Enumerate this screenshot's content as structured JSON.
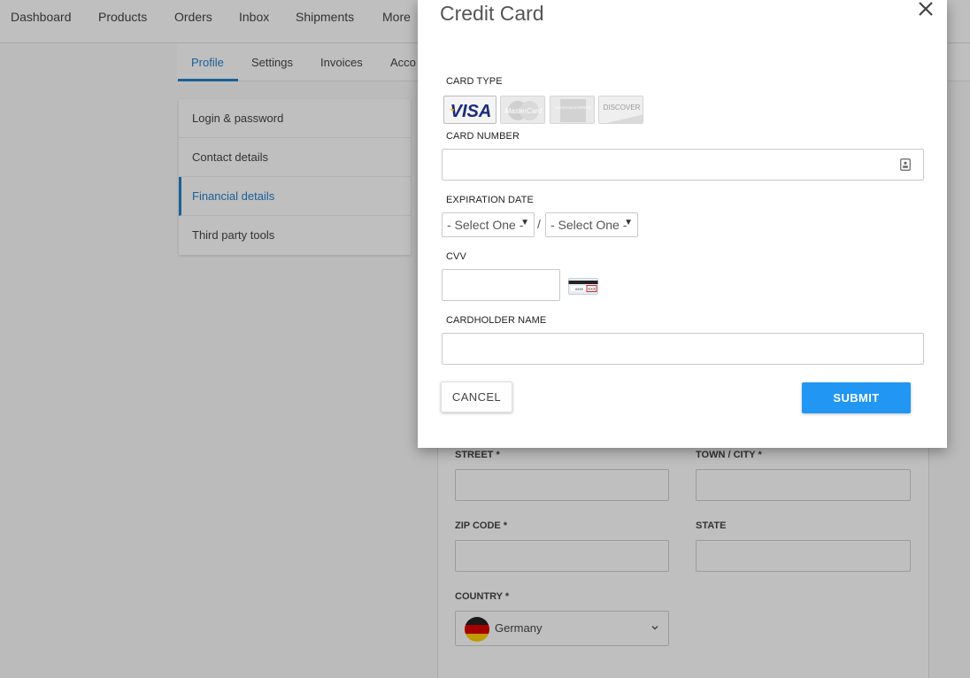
{
  "topnav": {
    "items": [
      "Dashboard",
      "Products",
      "Orders",
      "Inbox",
      "Shipments",
      "More"
    ]
  },
  "subtabs": {
    "items": [
      "Profile",
      "Settings",
      "Invoices",
      "Acco"
    ],
    "active": "Profile",
    "accent_color": "#2680c9"
  },
  "side_menu": {
    "items": [
      "Login & password",
      "Contact details",
      "Financial details",
      "Third party tools"
    ],
    "active": "Financial details"
  },
  "address_form": {
    "street_label": "STREET *",
    "town_label": "TOWN / CITY *",
    "zip_label": "ZIP CODE *",
    "state_label": "STATE",
    "country_label": "COUNTRY *",
    "country_value": "Germany",
    "country_flag": "germany-flag-icon"
  },
  "modal": {
    "title": "Credit Card",
    "card_type_label": "CARD TYPE",
    "card_types": {
      "visa": "VISA",
      "mastercard": "MasterCard",
      "amex": "AMERICAN EXPRESS",
      "discover": "DISCOVER"
    },
    "selected_card_type": "visa",
    "card_number_label": "CARD NUMBER",
    "card_number_value": "",
    "expiration_label": "EXPIRATION DATE",
    "month_select": "- Select One -",
    "year_select": "- Select One -",
    "date_separator": "/",
    "cvv_label": "CVV",
    "cvv_value": "",
    "cvv_icon_text": "xxxx",
    "cvv_icon_code": "XXX",
    "cardholder_label": "CARDHOLDER NAME",
    "cardholder_value": "",
    "cancel_label": "CANCEL",
    "submit_label": "SUBMIT",
    "submit_color": "#2196f3"
  }
}
